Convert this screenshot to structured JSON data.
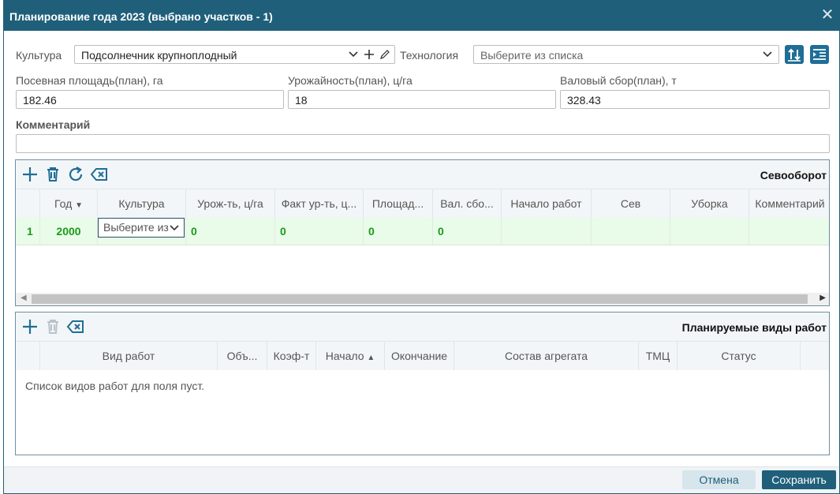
{
  "window": {
    "title": "Планирование года 2023 (выбрано участков - 1)"
  },
  "form": {
    "culture_label": "Культура",
    "culture_value": "Подсолнечник крупноплодный",
    "technology_label": "Технология",
    "technology_placeholder": "Выберите из списка",
    "area_label": "Посевная площадь(план), га",
    "area_value": "182.46",
    "yield_label": "Урожайность(план), ц/га",
    "yield_value": "18",
    "gross_label": "Валовый сбор(план), т",
    "gross_value": "328.43",
    "comment_label": "Комментарий",
    "comment_value": ""
  },
  "rotation": {
    "title": "Севооборот",
    "columns": [
      "Год",
      "Культура",
      "Урож-ть, ц/га",
      "Факт ур-ть, ц...",
      "Площад...",
      "Вал. сбо...",
      "Начало работ",
      "Сев",
      "Уборка",
      "Комментарий"
    ],
    "rows": [
      {
        "num": "1",
        "year": "2000",
        "culture_placeholder": "Выберите из",
        "yield": "0",
        "fact_yield": "0",
        "area": "0",
        "gross": "0",
        "start": "",
        "sowing": "",
        "harvest": "",
        "comment": ""
      }
    ]
  },
  "works": {
    "title": "Планируемые виды работ",
    "columns": [
      "Вид работ",
      "Объ...",
      "Коэф-т",
      "Начало",
      "Окончание",
      "Состав агрегата",
      "ТМЦ",
      "Статус"
    ],
    "empty_text": "Список видов работ для поля пуст."
  },
  "footer": {
    "cancel_label": "Отмена",
    "save_label": "Сохранить"
  },
  "colors": {
    "header_bg": "#1f5f7a",
    "accent": "#1f6e96",
    "row_bg": "#e9fbe9",
    "row_text": "#1a9a1a"
  }
}
